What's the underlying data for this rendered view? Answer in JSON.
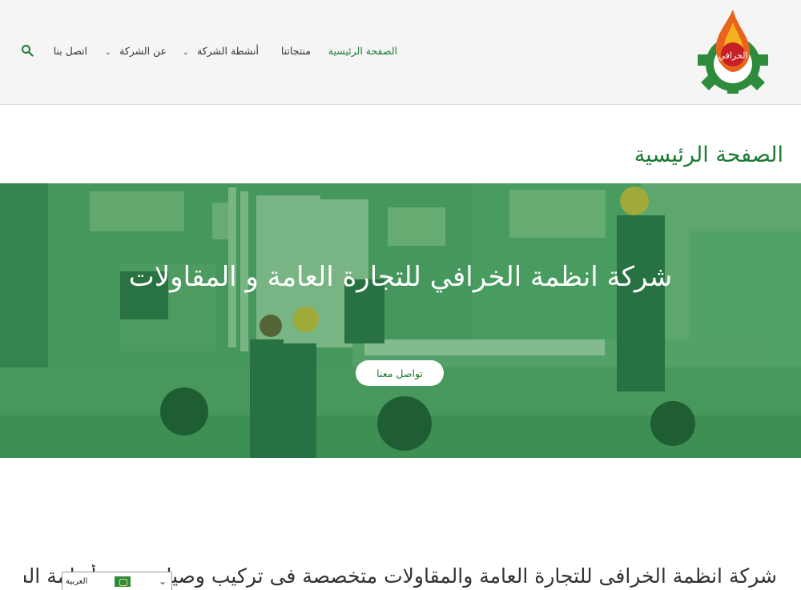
{
  "header": {
    "logo_text": "الخرافي",
    "nav": [
      {
        "label": "الصفحة الرئيسية",
        "active": true
      },
      {
        "label": "منتجاتنا",
        "active": false
      },
      {
        "label": "أنشطة الشركة",
        "active": false,
        "dropdown": true
      },
      {
        "label": "عن الشركة",
        "active": false,
        "dropdown": true
      },
      {
        "label": "اتصل بنا",
        "active": false
      }
    ],
    "search_icon": "search-icon"
  },
  "page": {
    "title": "الصفحة الرئيسية"
  },
  "hero": {
    "title": "شركة انظمة الخرافي للتجارة العامة و المقاولات",
    "button_label": "تواصل معنا"
  },
  "intro": {
    "text": "شركة انظمة الخرافى للتجارة العامة والمقاولات متخصصة فى تركيب وصيانة جميع أنظمة السلامة"
  },
  "language": {
    "label": "العربية",
    "flag": "saudi-flag-icon"
  },
  "colors": {
    "brand_green": "#1f7a36",
    "header_bg": "#f5f5f5"
  }
}
